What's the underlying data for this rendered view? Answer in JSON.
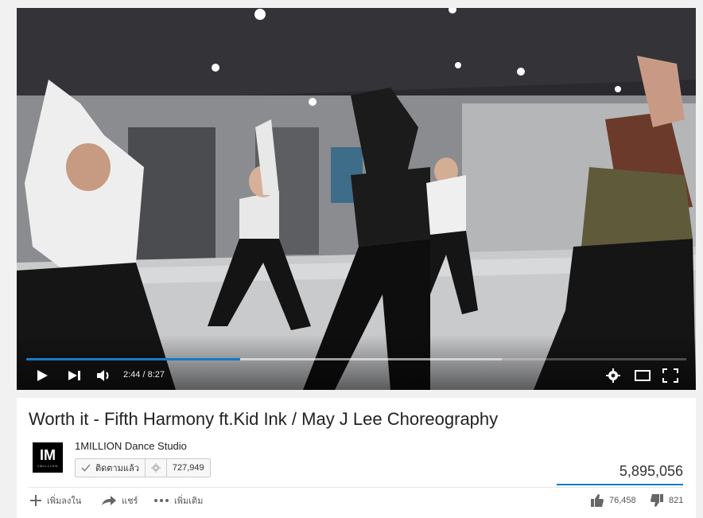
{
  "video": {
    "current_time": "2:44",
    "duration": "8:27",
    "time_display": "2:44 / 8:27",
    "played_fraction": 0.324,
    "buffered_fraction": 0.72,
    "progress_color": "#167ac6"
  },
  "controls": {
    "play_icon": "play-icon",
    "next_icon": "next-icon",
    "volume_icon": "volume-icon",
    "settings_icon": "gear-icon",
    "theater_icon": "theater-mode-icon",
    "fullscreen_icon": "fullscreen-icon"
  },
  "info": {
    "title": "Worth it - Fifth Harmony ft.Kid Ink / May J Lee Choreography",
    "channel_name": "1MILLION Dance Studio",
    "avatar_text": "IM",
    "avatar_subtext": "1MILLION",
    "subscribe_label": "ติดตามแล้ว",
    "subscriber_count": "727,949",
    "view_count": "5,895,056",
    "like_count": "76,458",
    "dislike_count": "821"
  },
  "actions": {
    "add_to": "เพิ่มลงใน",
    "share": "แชร์",
    "more": "เพิ่มเติม"
  }
}
